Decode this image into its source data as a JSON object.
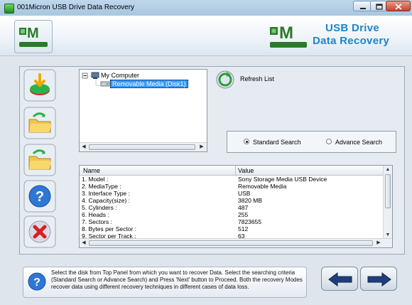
{
  "window": {
    "title": "001Micron USB Drive Data Recovery",
    "controls": [
      "minimize",
      "maximize",
      "close"
    ]
  },
  "header": {
    "brand_title": "USB Drive",
    "brand_subtitle": "Data Recovery",
    "logo_text_top": "001",
    "logo_text_letter": "M",
    "logo_text_bottom": "MICRON",
    "accent_color": "#1d84c9"
  },
  "sidebar": {
    "buttons": [
      {
        "name": "recover-disk",
        "icon": "disk-download-icon"
      },
      {
        "name": "open-folder",
        "icon": "folder-green-arrow-icon"
      },
      {
        "name": "open-folder-alt",
        "icon": "folder-green-arrow-icon"
      },
      {
        "name": "help",
        "icon": "question-icon"
      },
      {
        "name": "exit",
        "icon": "red-x-icon"
      }
    ]
  },
  "tree": {
    "root": "My Computer",
    "child": "Removable Media (Disk1)",
    "expander": "−"
  },
  "refresh": {
    "label": "Refresh List"
  },
  "search": {
    "options": [
      "Standard Search",
      "Advance Search"
    ],
    "selected": "Standard Search"
  },
  "table": {
    "columns": [
      "Name",
      "Value"
    ],
    "rows": [
      [
        "1. Model :",
        "Sony Storage Media USB Device"
      ],
      [
        "2. MediaType :",
        "Removable Media"
      ],
      [
        "3. Interface Type :",
        "USB"
      ],
      [
        "4. Capacity(size) :",
        "3820 MB"
      ],
      [
        "5. Cylinders :",
        "487"
      ],
      [
        "6. Heads :",
        "255"
      ],
      [
        "7. Sectors :",
        "7823655"
      ],
      [
        "8. Bytes per Sector :",
        "512"
      ],
      [
        "9. Sector per Track :",
        "63"
      ]
    ]
  },
  "footer": {
    "help_text": "Select the disk from Top Panel from which you want to recover Data. Select the searching criteria (Standard Search or Advance Search) and Press 'Next' button to Proceed. Both the recovery Modes recover data using different recovery techniques in different cases of data loss.",
    "back_icon": "back-arrow-icon",
    "next_icon": "next-arrow-icon"
  }
}
